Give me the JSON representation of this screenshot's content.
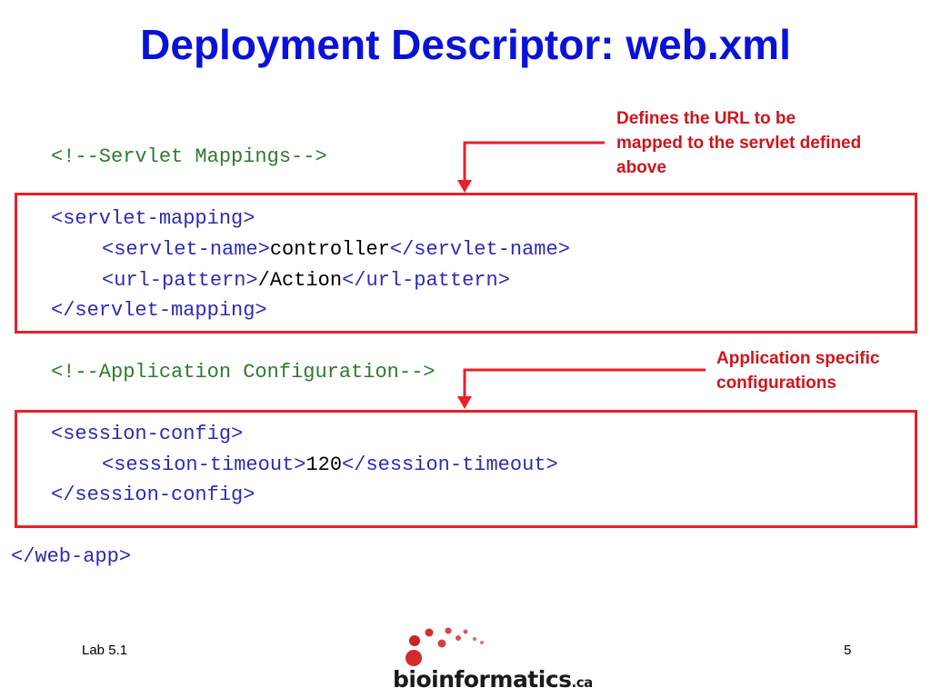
{
  "slide": {
    "title": "Deployment Descriptor: web.xml"
  },
  "code": {
    "comment_mappings": "<!--Servlet Mappings-->",
    "servlet_mapping_open": "<servlet-mapping>",
    "servlet_name_open": "<servlet-name>",
    "servlet_name_value": "controller",
    "servlet_name_close": "</servlet-name>",
    "url_pattern_open": "<url-pattern>",
    "url_pattern_value": "/Action",
    "url_pattern_close": "</url-pattern>",
    "servlet_mapping_close": "</servlet-mapping>",
    "comment_config": "<!--Application Configuration-->",
    "session_config_open": "<session-config>",
    "session_timeout_open": "<session-timeout>",
    "session_timeout_value": "120",
    "session_timeout_close": "</session-timeout>",
    "session_config_close": "</session-config>",
    "web_app_close": "</web-app>"
  },
  "annotations": {
    "mapping_note": [
      "Defines the URL to be",
      "mapped to the servlet defined",
      "above"
    ],
    "config_note": [
      "Application specific",
      "configurations"
    ]
  },
  "footer": {
    "lab": "Lab 5.1",
    "page_number": "5",
    "logo_text": "bioinformatics",
    "logo_suffix": ".ca"
  },
  "colors": {
    "title": "#0a12d8",
    "annotation": "#d0141c",
    "box_border": "#e8202a",
    "xml_tag": "#2d2ab8",
    "xml_comment": "#2e7a2e"
  }
}
